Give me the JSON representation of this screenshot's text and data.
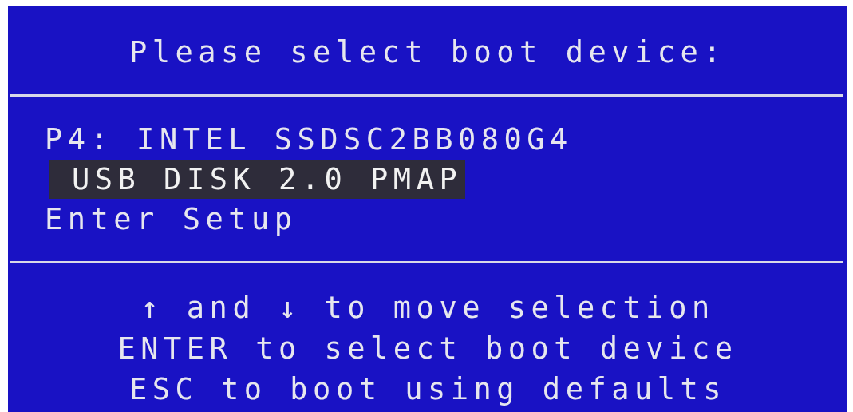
{
  "title": "Please select boot device:",
  "devices": [
    {
      "label": "P4: INTEL SSDSC2BB080G4",
      "selected": false
    },
    {
      "label": "USB DISK 2.0 PMAP",
      "selected": true
    },
    {
      "label": "Enter Setup",
      "selected": false
    }
  ],
  "help_lines": [
    "↑ and ↓ to move selection",
    "ENTER to select boot device",
    "ESC to boot using defaults"
  ]
}
